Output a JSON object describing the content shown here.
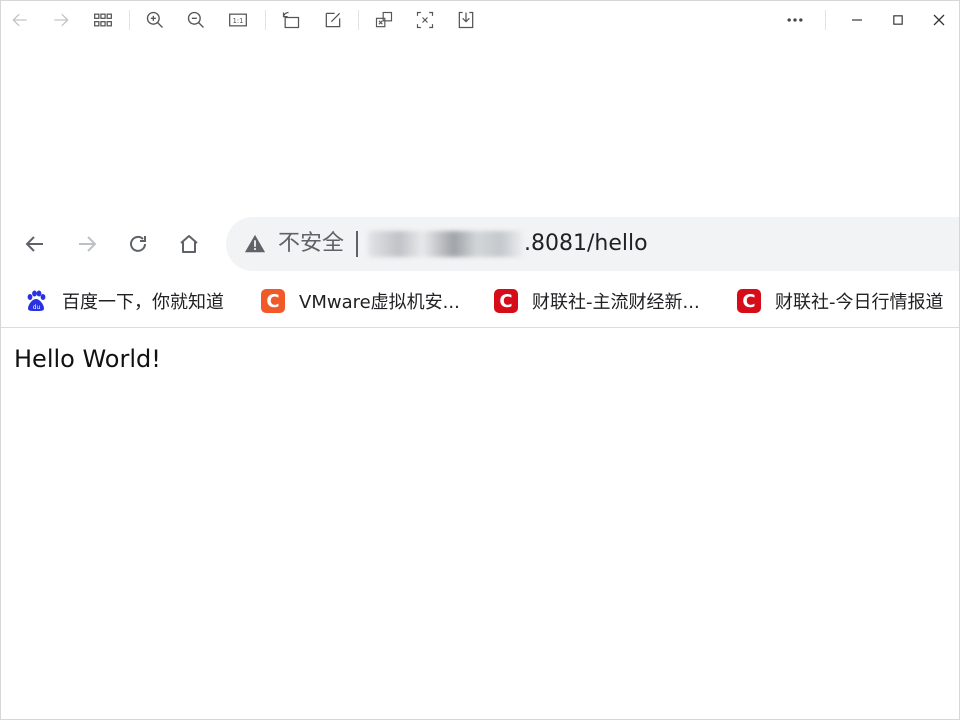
{
  "viewer_toolbar": {
    "buttons": [
      {
        "icon": "back-arrow-icon"
      },
      {
        "icon": "forward-arrow-icon"
      },
      {
        "icon": "grid-icon"
      },
      {
        "icon": "zoom-in-icon"
      },
      {
        "icon": "zoom-out-icon"
      },
      {
        "icon": "actual-size-icon",
        "label": "1:1"
      },
      {
        "icon": "rotate-icon"
      },
      {
        "icon": "edit-icon"
      },
      {
        "icon": "image-transform-icon"
      },
      {
        "icon": "text-extract-icon"
      },
      {
        "icon": "download-icon"
      },
      {
        "icon": "more-icon"
      },
      {
        "icon": "minimize-icon"
      },
      {
        "icon": "maximize-icon"
      },
      {
        "icon": "close-icon"
      }
    ]
  },
  "browser": {
    "omnibox": {
      "security_label": "不安全",
      "url_visible": ".8081/hello"
    },
    "bookmarks": [
      {
        "label": "百度一下，你就知道",
        "icon": "baidu-paw-icon",
        "color": "#2932e1"
      },
      {
        "label": "VMware虚拟机安...",
        "icon": "c-logo-icon",
        "color": "#f05a28"
      },
      {
        "label": "财联社-主流财经新...",
        "icon": "c-logo-icon",
        "color": "#d70c19"
      },
      {
        "label": "财联社-今日行情报道",
        "icon": "c-logo-icon",
        "color": "#d70c19"
      }
    ]
  },
  "page": {
    "content_text": "Hello World!"
  },
  "colors": {
    "icon_gray": "#5f6368",
    "disabled_gray": "#bdc1c6",
    "omnibox_bg": "#f1f3f4"
  }
}
